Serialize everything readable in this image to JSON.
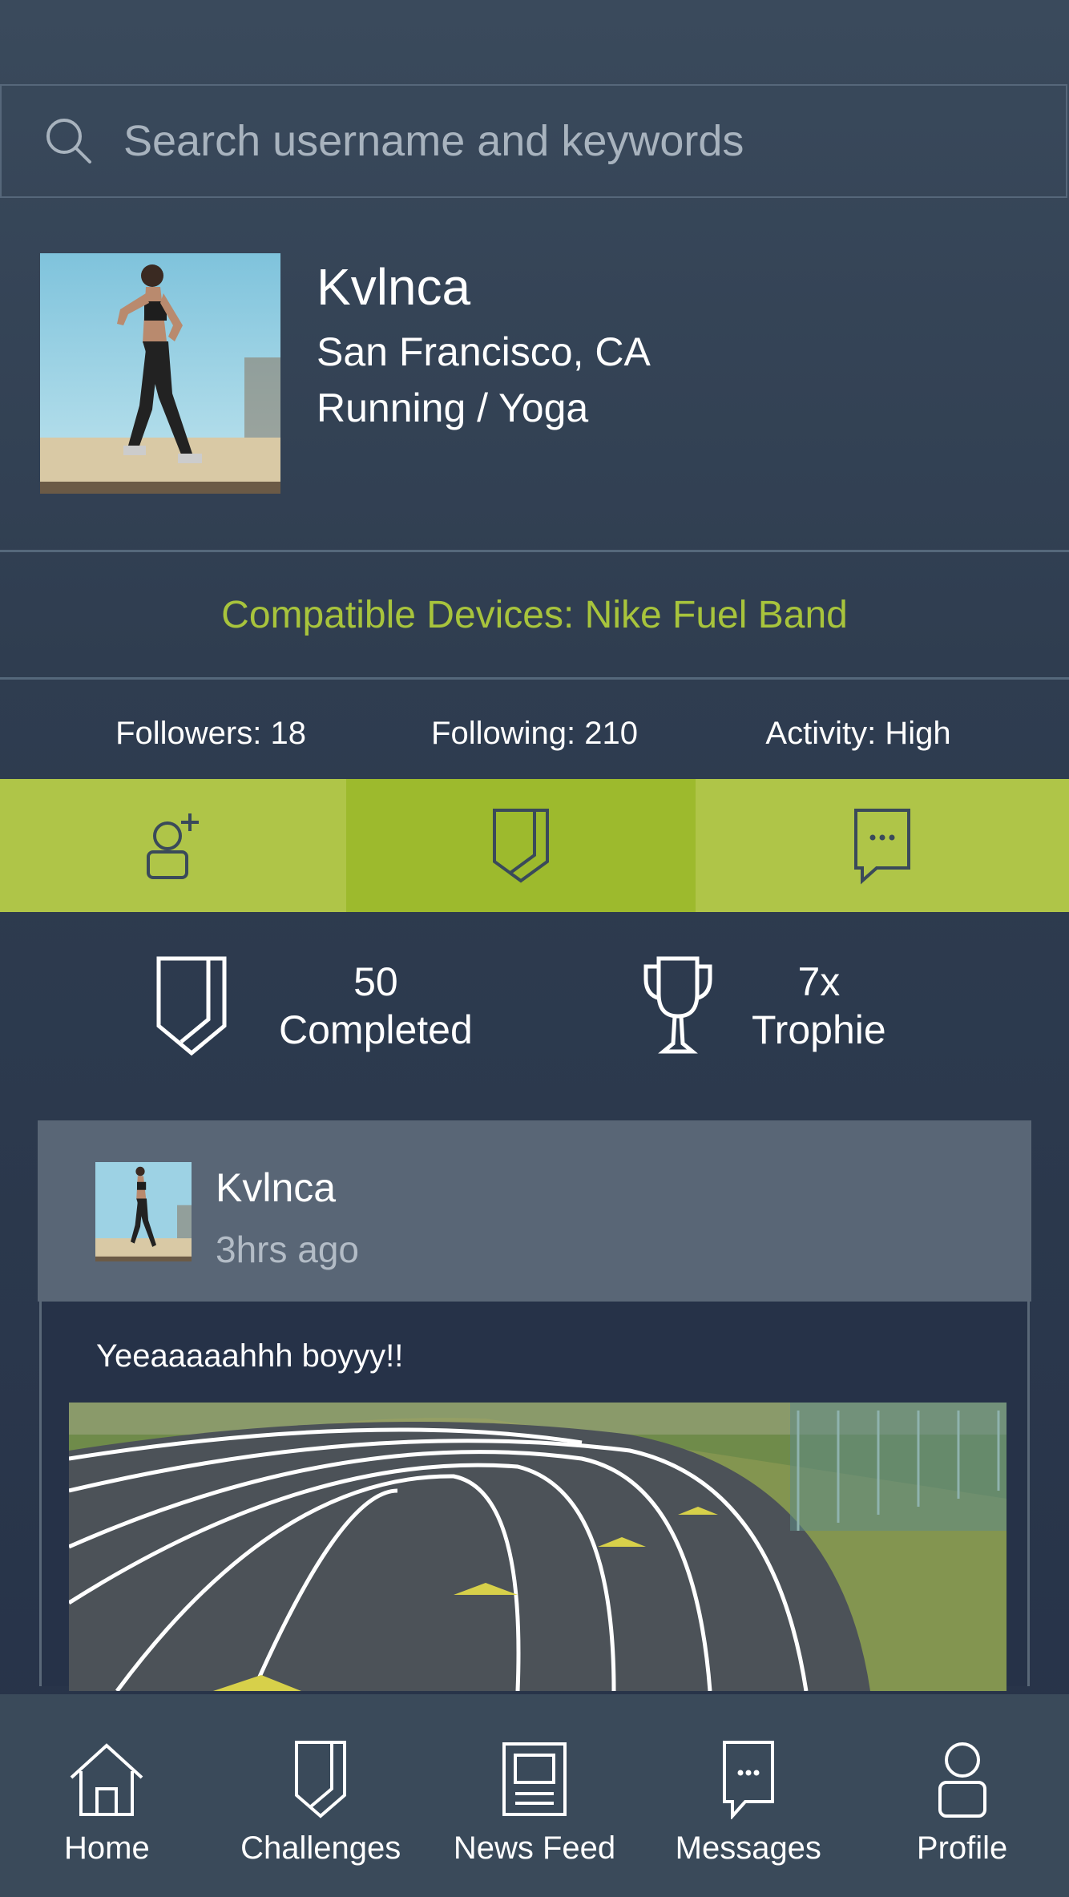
{
  "search": {
    "placeholder": "Search username and keywords"
  },
  "profile": {
    "username": "Kvlnca",
    "location": "San Francisco, CA",
    "activities": "Running  /  Yoga"
  },
  "devices": {
    "text": "Compatible Devices: Nike Fuel Band"
  },
  "stats": {
    "followers": "Followers: 18",
    "following": "Following: 210",
    "activity": "Activity: High"
  },
  "actions": {
    "items": [
      {
        "icon": "add-user-icon"
      },
      {
        "icon": "badge-icon",
        "active": true
      },
      {
        "icon": "message-icon"
      }
    ],
    "colors": {
      "normal": "#afc548",
      "active": "#9dba2d"
    }
  },
  "achievements": {
    "completed": {
      "count": "50",
      "label": "Completed"
    },
    "trophies": {
      "count": "7x",
      "label": "Trophie"
    }
  },
  "post": {
    "username": "Kvlnca",
    "time": "3hrs ago",
    "text": "Yeeaaaaahhh boyyy!!"
  },
  "tabbar": {
    "items": [
      {
        "label": "Home",
        "icon": "home-icon"
      },
      {
        "label": "Challenges",
        "icon": "badge-icon"
      },
      {
        "label": "News Feed",
        "icon": "newspaper-icon"
      },
      {
        "label": "Messages",
        "icon": "message-icon"
      },
      {
        "label": "Profile",
        "icon": "person-icon"
      }
    ]
  },
  "colors": {
    "accent": "#a8c43c",
    "background": "#2f3d50"
  }
}
